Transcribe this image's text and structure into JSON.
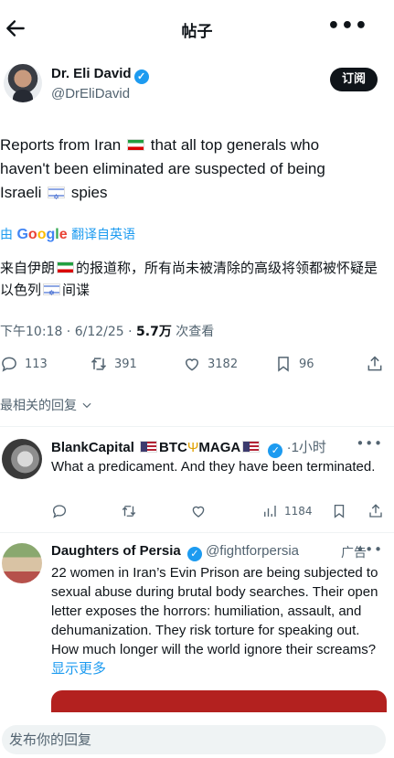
{
  "header": {
    "title": "帖子",
    "back_icon": "arrow-left-icon",
    "more_label": "•••"
  },
  "tweet": {
    "author_name": "Dr. Eli David",
    "author_handle": "@DrEliDavid",
    "subscribe_label": "订阅",
    "text_line1_a": "Reports from Iran",
    "text_line1_b": "that all top generals who",
    "text_line2": "haven't been eliminated are suspected of being",
    "text_line3_a": "Israeli",
    "text_line3_b": "spies",
    "translate_prefix": "由",
    "translate_google": "Google",
    "translate_suffix": "翻译自英语",
    "translated_a": "来自伊朗",
    "translated_b": "的报道称，所有尚未被清除的高级将领都被怀疑是以色列",
    "translated_c": "间谍",
    "time": "下午10:18 · 6/12/25 · ",
    "views": "5.7万",
    "views_label": " 次查看",
    "stats": {
      "replies": "113",
      "retweets": "391",
      "likes": "3182",
      "bookmarks": "96"
    }
  },
  "sort_label": "最相关的回复",
  "replies": [
    {
      "name_a": "BlankCapital",
      "name_b": "BTC",
      "name_c": "MAGA",
      "time": "·1小时",
      "text": "What a predicament. And they have been terminated.",
      "views": "1184",
      "more": "•••"
    },
    {
      "name": "Daughters of Persia",
      "handle": "@fightforpersia",
      "ad_label": "广告",
      "text": "22 women in Iran’s Evin Prison are being subjected to sexual abuse during brutal body searches. Their open letter exposes the horrors: humiliation, assault, and dehumanization. They risk torture for speaking out. How much longer will the world ignore their screams?",
      "show_more": "显示更多",
      "more": "•••"
    }
  ],
  "composer": {
    "placeholder": "发布你的回复"
  },
  "colors": {
    "accent": "#1d9bf0",
    "text": "#0f1419",
    "muted": "#536471",
    "button_dark": "#0f1419"
  }
}
